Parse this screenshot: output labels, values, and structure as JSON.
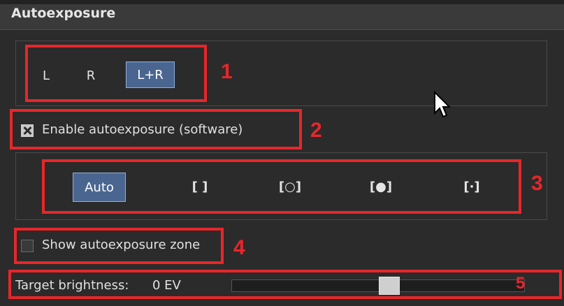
{
  "panel": {
    "title": "Autoexposure"
  },
  "eye_selector": {
    "options": [
      "L",
      "R",
      "L+R"
    ],
    "selected": "L+R"
  },
  "enable_checkbox": {
    "label": "Enable autoexposure (software)",
    "checked": true
  },
  "mode_selector": {
    "options": [
      "Auto",
      "[ ]",
      "[○]",
      "[●]",
      "[·]"
    ],
    "selected": "Auto"
  },
  "zone_checkbox": {
    "label": "Show autoexposure zone",
    "checked": false
  },
  "brightness": {
    "label": "Target brightness:",
    "value_text": "0 EV",
    "slider_fraction": 0.52
  },
  "annotations": [
    "1",
    "2",
    "3",
    "4",
    "5"
  ],
  "colors": {
    "accent": "#4a6690",
    "annotation": "#e8262a",
    "background": "#2b2b2b"
  }
}
